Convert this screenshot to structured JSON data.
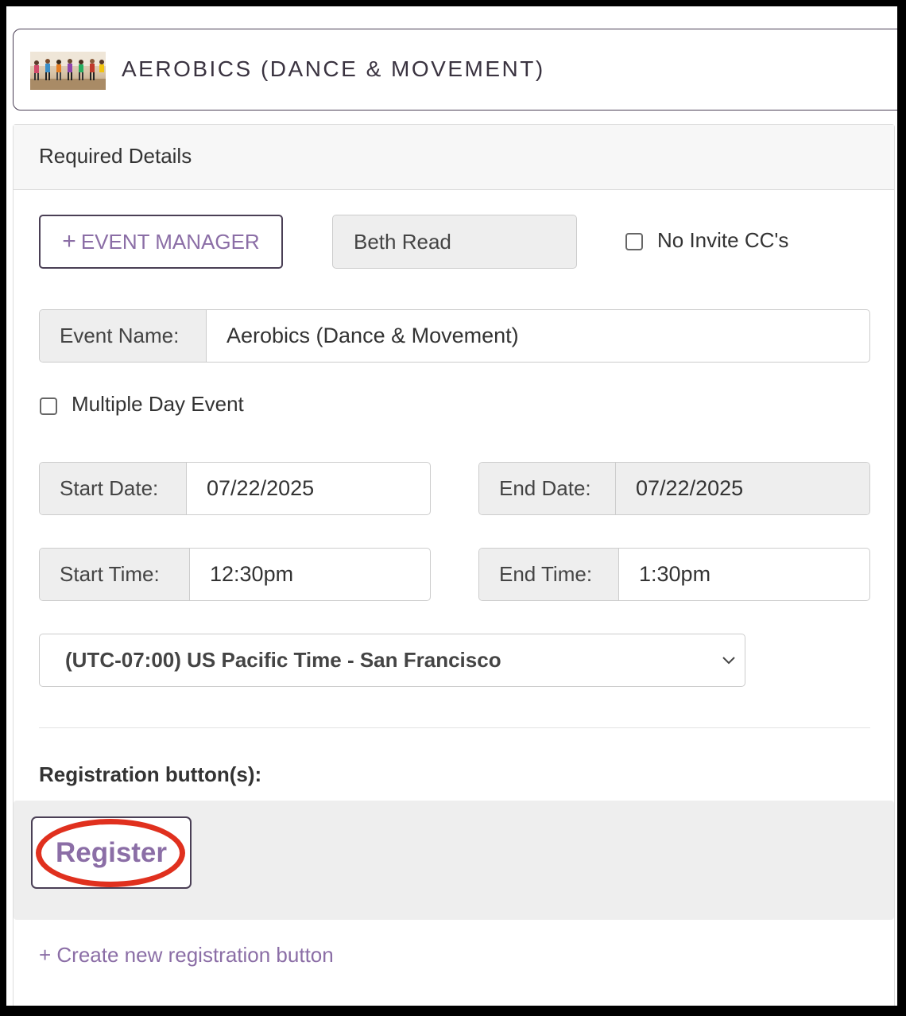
{
  "event": {
    "title": "AEROBICS (DANCE & MOVEMENT)",
    "thumbnail_icon": "aerobics-class-photo"
  },
  "card": {
    "header_title": "Required Details"
  },
  "event_manager": {
    "button_label": "EVENT MANAGER",
    "button_icon": "plus-icon",
    "manager_name": "Beth Read"
  },
  "no_invite_cc": {
    "label": "No Invite CC's",
    "checked": false
  },
  "event_name": {
    "label": "Event Name:",
    "value": "Aerobics (Dance & Movement)"
  },
  "multiple_day": {
    "label": "Multiple Day Event",
    "checked": false
  },
  "start_date": {
    "label": "Start Date:",
    "value": "07/22/2025"
  },
  "end_date": {
    "label": "End Date:",
    "value": "07/22/2025"
  },
  "start_time": {
    "label": "Start Time:",
    "value": "12:30pm"
  },
  "end_time": {
    "label": "End Time:",
    "value": "1:30pm"
  },
  "timezone": {
    "selected": "(UTC-07:00) US Pacific Time - San Francisco"
  },
  "registration": {
    "section_label": "Registration button(s):",
    "buttons": [
      {
        "label": "Register",
        "highlighted": true
      }
    ],
    "create_link": "+ Create new registration button"
  },
  "colors": {
    "accent": "#8b6ea6",
    "border_dark": "#4a3f55",
    "highlight": "#e0301e",
    "field_bg": "#eeeeee"
  }
}
